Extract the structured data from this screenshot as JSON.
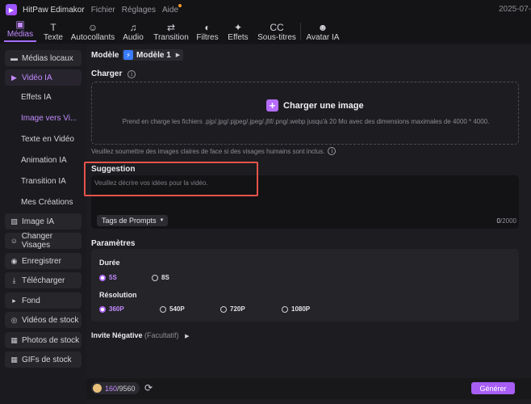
{
  "titlebar": {
    "app_name": "HitPaw Edimakor",
    "menu": [
      "Fichier",
      "Réglages",
      "Aide"
    ],
    "date": "2025-07-"
  },
  "toolbar": {
    "tabs": [
      {
        "label": "Médias",
        "icon": "media-icon",
        "glyph": "▣",
        "active": true
      },
      {
        "label": "Texte",
        "icon": "text-icon",
        "glyph": "T",
        "active": false
      },
      {
        "label": "Autocollants",
        "icon": "sticker-icon",
        "glyph": "☺",
        "active": false
      },
      {
        "label": "Audio",
        "icon": "music-note-icon",
        "glyph": "♫",
        "active": false
      },
      {
        "label": "Transition",
        "icon": "transition-arrows-icon",
        "glyph": "⇄",
        "active": false
      },
      {
        "label": "Filtres",
        "icon": "filter-icon",
        "glyph": "◐",
        "active": false
      },
      {
        "label": "Effets",
        "icon": "sparkle-icon",
        "glyph": "✦",
        "active": false
      },
      {
        "label": "Sous-titres",
        "icon": "subtitles-icon",
        "glyph": "CC",
        "active": false
      },
      {
        "label": "Avatar IA",
        "icon": "avatar-icon",
        "glyph": "☻",
        "active": false
      }
    ]
  },
  "sidebar": {
    "items": [
      {
        "label": "Médias locaux",
        "icon": "folder-icon",
        "glyph": "▬",
        "active": false
      },
      {
        "label": "Vidéo IA",
        "icon": "ai-video-icon",
        "glyph": "▶",
        "active": true
      },
      {
        "label": "Image IA",
        "icon": "ai-image-icon",
        "glyph": "▧",
        "active": false
      },
      {
        "label": "Changer Visages",
        "icon": "face-swap-icon",
        "glyph": "☺",
        "active": false
      },
      {
        "label": "Enregistrer",
        "icon": "record-icon",
        "glyph": "◉",
        "active": false
      },
      {
        "label": "Télécharger",
        "icon": "download-icon",
        "glyph": "⤓",
        "active": false
      },
      {
        "label": "Fond",
        "icon": "play-background-icon",
        "glyph": "▸",
        "active": false
      },
      {
        "label": "Vidéos de stock",
        "icon": "stock-video-icon",
        "glyph": "◎",
        "active": false
      },
      {
        "label": "Photos de stock",
        "icon": "stock-photo-icon",
        "glyph": "▦",
        "active": false
      },
      {
        "label": "GIFs de stock",
        "icon": "gif-icon",
        "glyph": "▦",
        "active": false
      }
    ],
    "subitems": [
      {
        "label": "Effets IA",
        "active": false
      },
      {
        "label": "Image vers Vi...",
        "active": true
      },
      {
        "label": "Texte en Vidéo",
        "active": false
      },
      {
        "label": "Animation IA",
        "active": false
      },
      {
        "label": "Transition IA",
        "active": false
      },
      {
        "label": "Mes Créations",
        "active": false
      }
    ]
  },
  "main": {
    "model_label": "Modèle",
    "model_value": "Modèle 1",
    "upload_label": "Charger",
    "upload_button": "Charger une image",
    "upload_hint": "Prend en charge les fichiers .pjp/.jpg/.pjpeg/.jpeg/.jfif/.png/.webp jusqu'à 20 Mo avec des dimensions maximales de 4000 * 4000.",
    "face_hint": "Veuillez soumettre des images claires de face si des visages humains sont inclus.",
    "suggestion_label": "Suggestion",
    "suggestion_placeholder": "Veuillez décrire vos idées pour la vidéo.",
    "tags_button": "Tags de Prompts",
    "char_count": "0",
    "char_max": "/2000",
    "params_label": "Paramètres",
    "duration_label": "Durée",
    "durations": [
      {
        "label": "5S",
        "selected": true
      },
      {
        "label": "8S",
        "selected": false
      }
    ],
    "resolution_label": "Résolution",
    "resolutions": [
      {
        "label": "360P",
        "selected": true
      },
      {
        "label": "540P",
        "selected": false
      },
      {
        "label": "720P",
        "selected": false
      },
      {
        "label": "1080P",
        "selected": false
      }
    ],
    "negative_label": "Invite Négative",
    "negative_optional": "(Facultatif)"
  },
  "bottom": {
    "credits_used": "160",
    "credits_total": "/9560",
    "generate_button": "Générer"
  },
  "colors": {
    "accent": "#a85ef5",
    "accent_text": "#c38bff",
    "highlight": "#e5534b"
  }
}
